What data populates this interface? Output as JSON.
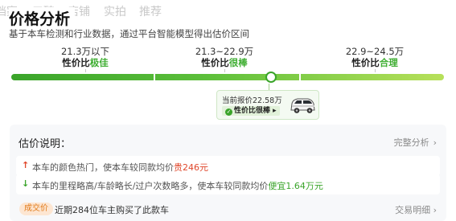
{
  "tabs": [
    "档案",
    "口碑",
    "店铺",
    "实拍",
    "推荐"
  ],
  "title": "价格分析",
  "subtitle": "基于本车检测和行业数据，通过平台智能模型得出估价区间",
  "ranges": [
    {
      "price": "21.3万以下",
      "level_prefix": "性价比",
      "level_em": "极佳"
    },
    {
      "price": "21.3~22.9万",
      "level_prefix": "性价比",
      "level_em": "很棒"
    },
    {
      "price": "22.9~24.5万",
      "level_prefix": "性价比",
      "level_em": "合理"
    }
  ],
  "bar": {
    "position_fraction": 0.595
  },
  "quote": {
    "label": "当前报价22.58万",
    "badge_text": "性价比很棒",
    "badge_arrow": "▸",
    "check": "✓"
  },
  "estimate": {
    "title": "估价说明：",
    "link": "完整分析",
    "chevron": "›",
    "items": [
      {
        "arrow": "↑",
        "text": "本车的颜色热门，使本车较同款均价",
        "highlight": "贵246元"
      },
      {
        "arrow": "↓",
        "text": "本车的里程略高/车龄略长/过户次数略多，使本车较同款均价",
        "highlight": "便宜1.64万元"
      }
    ]
  },
  "footer": {
    "badge": "成交价",
    "text": "近期284位车主购买了此款车",
    "link": "交易明细",
    "chevron": "›"
  },
  "colors": {
    "green": "#3aa42a",
    "red": "#e0472b",
    "orange": "#e07a1a"
  }
}
